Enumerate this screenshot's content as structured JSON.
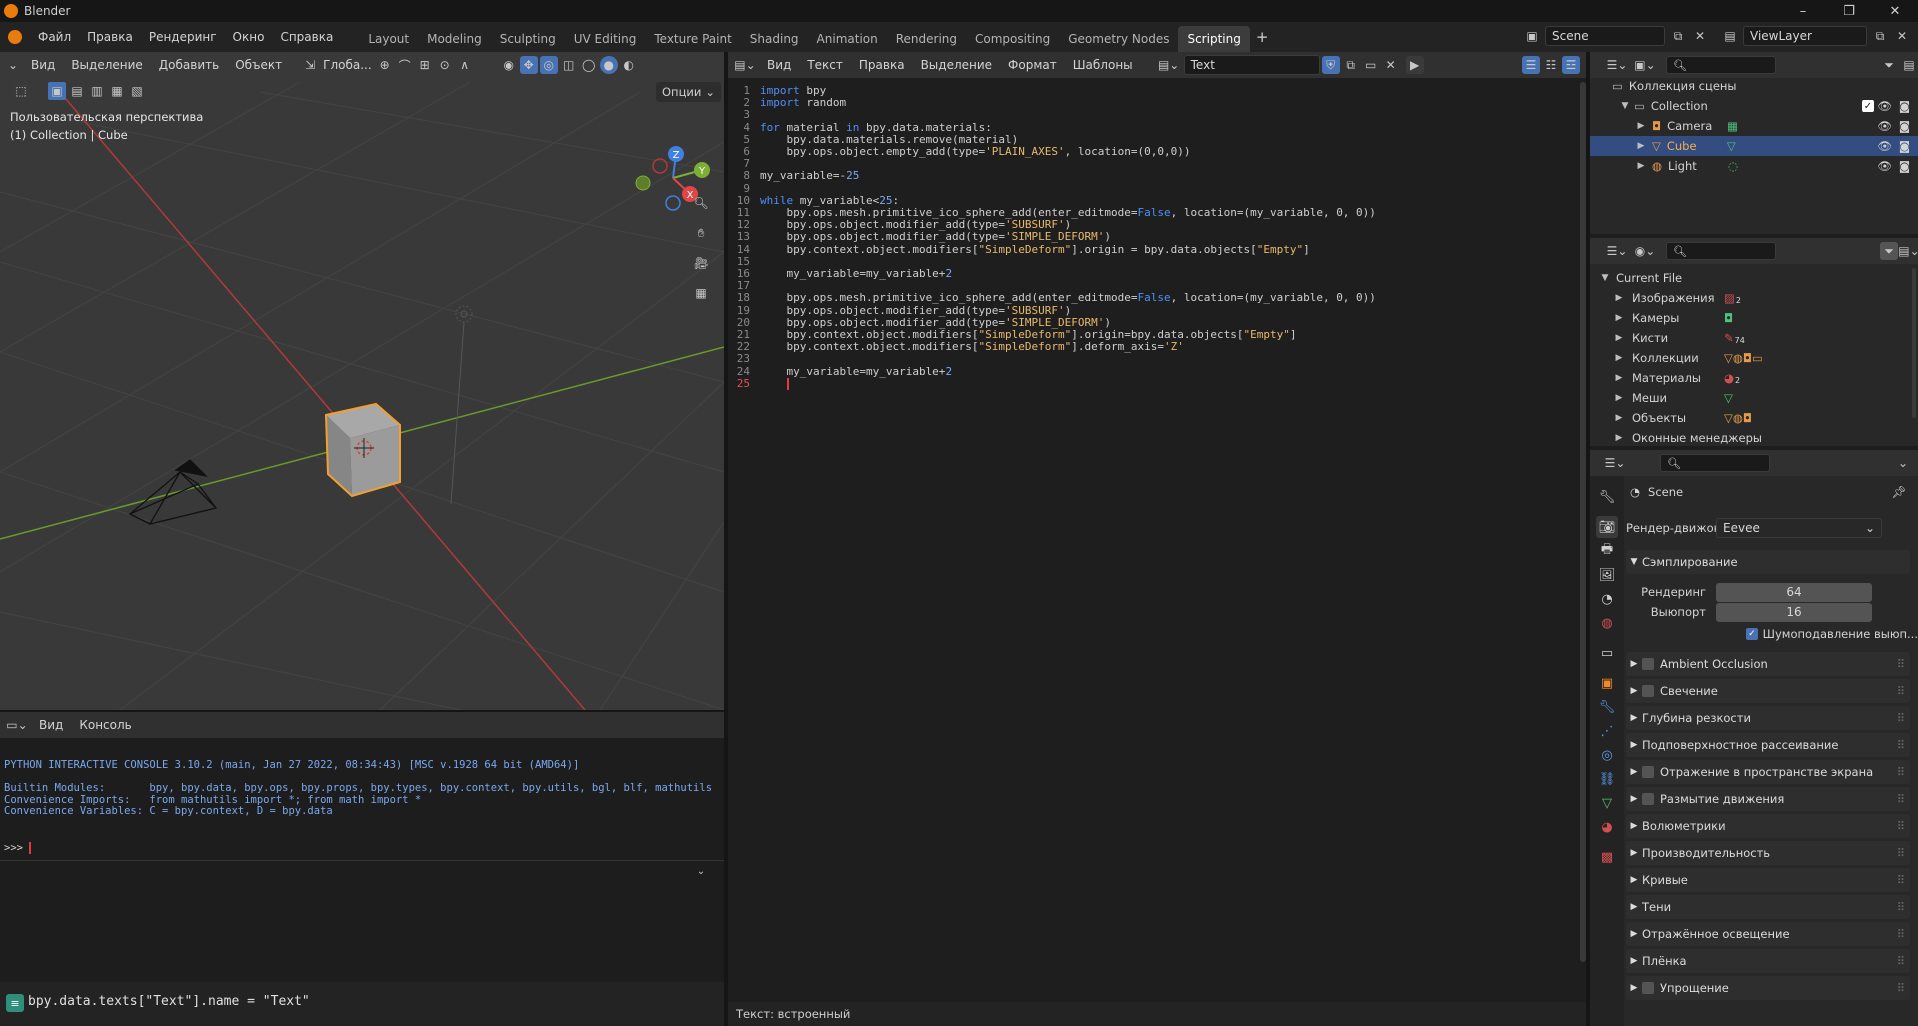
{
  "app": {
    "title": "Blender"
  },
  "window_controls": {
    "minimize": "–",
    "maximize": "❐",
    "close": "✕"
  },
  "menu": [
    "Файл",
    "Правка",
    "Рендеринг",
    "Окно",
    "Справка"
  ],
  "workspaces": [
    {
      "label": "Layout",
      "active": false
    },
    {
      "label": "Modeling",
      "active": false
    },
    {
      "label": "Sculpting",
      "active": false
    },
    {
      "label": "UV Editing",
      "active": false
    },
    {
      "label": "Texture Paint",
      "active": false
    },
    {
      "label": "Shading",
      "active": false
    },
    {
      "label": "Animation",
      "active": false
    },
    {
      "label": "Rendering",
      "active": false
    },
    {
      "label": "Compositing",
      "active": false
    },
    {
      "label": "Geometry Nodes",
      "active": false
    },
    {
      "label": "Scripting",
      "active": true
    }
  ],
  "add_workspace": "+",
  "scene_selector": {
    "value": "Scene"
  },
  "viewlayer_selector": {
    "value": "ViewLayer"
  },
  "viewport": {
    "menus": [
      "Вид",
      "Выделение",
      "Добавить",
      "Объект"
    ],
    "orientation": "Глоба...",
    "options": "Опции",
    "view_name": "Пользовательская перспектива",
    "view_info": "(1) Collection | Cube",
    "gizmo": {
      "z": "Z",
      "y": "Y",
      "x": "X"
    }
  },
  "console": {
    "menus": [
      "Вид",
      "Консоль"
    ],
    "lines": [
      "PYTHON INTERACTIVE CONSOLE 3.10.2 (main, Jan 27 2022, 08:34:43) [MSC v.1928 64 bit (AMD64)]",
      "",
      "Builtin Modules:       bpy, bpy.data, bpy.ops, bpy.props, bpy.types, bpy.context, bpy.utils, bgl, blf, mathutils",
      "Convenience Imports:   from mathutils import *; from math import *",
      "Convenience Variables: C = bpy.context, D = bpy.data"
    ],
    "prompt": ">>> "
  },
  "statusbar": {
    "info": "bpy.data.texts[\"Text\"].name = \"Text\""
  },
  "text_editor": {
    "menus": [
      "Вид",
      "Текст",
      "Правка",
      "Выделение",
      "Формат",
      "Шаблоны"
    ],
    "text_name": "Text",
    "footer": "Текст: встроенный",
    "code": [
      [
        [
          "kw",
          "import"
        ],
        [
          "ts",
          " bpy"
        ]
      ],
      [
        [
          "kw",
          "import"
        ],
        [
          "ts",
          " random"
        ]
      ],
      [],
      [
        [
          "kw",
          "for"
        ],
        [
          "ts",
          " material "
        ],
        [
          "kw",
          "in"
        ],
        [
          "ts",
          " bpy.data.materials:"
        ]
      ],
      [
        [
          "ts",
          "    bpy.data.materials.remove(material)"
        ]
      ],
      [
        [
          "ts",
          "    bpy.ops.object.empty_add(type="
        ],
        [
          "st",
          "'PLAIN_AXES'"
        ],
        [
          "ts",
          ", location=(0,0,0))"
        ]
      ],
      [],
      [
        [
          "ts",
          "my_variable=-"
        ],
        [
          "nm",
          "25"
        ]
      ],
      [],
      [
        [
          "kw",
          "while"
        ],
        [
          "ts",
          " my_variable<"
        ],
        [
          "nm",
          "25"
        ],
        [
          "ts",
          ":"
        ]
      ],
      [
        [
          "ts",
          "    bpy.ops.mesh.primitive_ico_sphere_add(enter_editmode="
        ],
        [
          "kw",
          "False"
        ],
        [
          "ts",
          ", location=(my_variable, 0, 0))"
        ]
      ],
      [
        [
          "ts",
          "    bpy.ops.object.modifier_add(type="
        ],
        [
          "st",
          "'SUBSURF'"
        ],
        [
          "ts",
          ")"
        ]
      ],
      [
        [
          "ts",
          "    bpy.ops.object.modifier_add(type="
        ],
        [
          "st",
          "'SIMPLE_DEFORM'"
        ],
        [
          "ts",
          ")"
        ]
      ],
      [
        [
          "ts",
          "    bpy.context.object.modifiers["
        ],
        [
          "st",
          "\"SimpleDeform\""
        ],
        [
          "ts",
          "].origin = bpy.data.objects["
        ],
        [
          "st",
          "\"Empty\""
        ],
        [
          "ts",
          "]"
        ]
      ],
      [],
      [
        [
          "ts",
          "    my_variable=my_variable+"
        ],
        [
          "nm",
          "2"
        ]
      ],
      [],
      [
        [
          "ts",
          "    bpy.ops.mesh.primitive_ico_sphere_add(enter_editmode="
        ],
        [
          "kw",
          "False"
        ],
        [
          "ts",
          ", location=(my_variable, 0, 0))"
        ]
      ],
      [
        [
          "ts",
          "    bpy.ops.object.modifier_add(type="
        ],
        [
          "st",
          "'SUBSURF'"
        ],
        [
          "ts",
          ")"
        ]
      ],
      [
        [
          "ts",
          "    bpy.ops.object.modifier_add(type="
        ],
        [
          "st",
          "'SIMPLE_DEFORM'"
        ],
        [
          "ts",
          ")"
        ]
      ],
      [
        [
          "ts",
          "    bpy.context.object.modifiers["
        ],
        [
          "st",
          "\"SimpleDeform\""
        ],
        [
          "ts",
          "].origin=bpy.data.objects["
        ],
        [
          "st",
          "\"Empty\""
        ],
        [
          "ts",
          "]"
        ]
      ],
      [
        [
          "ts",
          "    bpy.context.object.modifiers["
        ],
        [
          "st",
          "\"SimpleDeform\""
        ],
        [
          "ts",
          "].deform_axis="
        ],
        [
          "st",
          "'Z'"
        ]
      ],
      [],
      [
        [
          "ts",
          "    my_variable=my_variable+"
        ],
        [
          "nm",
          "2"
        ]
      ],
      [
        [
          "ts",
          "    "
        ]
      ]
    ]
  },
  "outliner": {
    "root": "Коллекция сцены",
    "collection": "Collection",
    "items": [
      {
        "label": "Camera",
        "selected": false
      },
      {
        "label": "Cube",
        "selected": true
      },
      {
        "label": "Light",
        "selected": false
      }
    ]
  },
  "file_view": {
    "root": "Current File",
    "items": [
      {
        "label": "Изображения",
        "count": "2"
      },
      {
        "label": "Камеры",
        "count": ""
      },
      {
        "label": "Кисти",
        "count": "74"
      },
      {
        "label": "Коллекции",
        "count": ""
      },
      {
        "label": "Материалы",
        "count": "2"
      },
      {
        "label": "Меши",
        "count": ""
      },
      {
        "label": "Объекты",
        "count": ""
      },
      {
        "label": "Оконные менеджеры",
        "count": ""
      }
    ]
  },
  "properties": {
    "scene_name": "Scene",
    "render_engine_label": "Рендер-движок",
    "render_engine_value": "Eevee",
    "sampling_title": "Сэмплирование",
    "render_label": "Рендеринг",
    "render_value": "64",
    "viewport_label": "Выюпорт",
    "viewport_value": "16",
    "denoise_label": "Шумоподавление выюп...",
    "panels": [
      {
        "label": "Ambient Occlusion",
        "checkbox": true
      },
      {
        "label": "Свечение",
        "checkbox": true
      },
      {
        "label": "Глубина резкости",
        "checkbox": false
      },
      {
        "label": "Подповерхностное рассеивание",
        "checkbox": false
      },
      {
        "label": "Отражение в пространстве экрана",
        "checkbox": true
      },
      {
        "label": "Размытие движения",
        "checkbox": true
      },
      {
        "label": "Волюметрики",
        "checkbox": false
      },
      {
        "label": "Производительность",
        "checkbox": false
      },
      {
        "label": "Кривые",
        "checkbox": false
      },
      {
        "label": "Тени",
        "checkbox": false
      },
      {
        "label": "Отражённое освещение",
        "checkbox": false
      },
      {
        "label": "Плёнка",
        "checkbox": false
      },
      {
        "label": "Упрощение",
        "checkbox": true
      }
    ]
  },
  "colors": {
    "accent": "#4772b3",
    "selected_object": "#e8a13c",
    "keyword": "#4f8ff7",
    "string": "#e9b96e",
    "number": "#7aa9f2",
    "cursor": "#e03c3c"
  }
}
